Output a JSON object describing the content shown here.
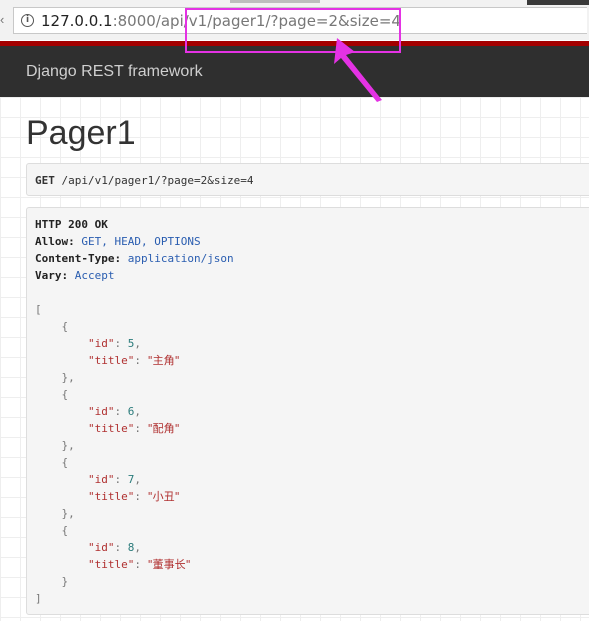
{
  "browser": {
    "url_host": "127.0.0.1",
    "url_rest": ":8000/api/v1/pager1/?page=2&size=4",
    "info_icon": "info-circle-icon"
  },
  "navbar": {
    "brand": "Django REST framework"
  },
  "page": {
    "title": "Pager1"
  },
  "request": {
    "method": "GET",
    "path": "/api/v1/pager1/?page=2&size=4"
  },
  "response": {
    "status_line": "HTTP 200 OK",
    "headers": [
      {
        "key": "Allow:",
        "value": "GET, HEAD, OPTIONS"
      },
      {
        "key": "Content-Type:",
        "value": "application/json"
      },
      {
        "key": "Vary:",
        "value": "Accept"
      }
    ],
    "items": [
      {
        "id_key": "\"id\"",
        "id": "5",
        "title_key": "\"title\"",
        "title": "\"主角\""
      },
      {
        "id_key": "\"id\"",
        "id": "6",
        "title_key": "\"title\"",
        "title": "\"配角\""
      },
      {
        "id_key": "\"id\"",
        "id": "7",
        "title_key": "\"title\"",
        "title": "\"小丑\""
      },
      {
        "id_key": "\"id\"",
        "id": "8",
        "title_key": "\"title\"",
        "title": "\"董事长\""
      }
    ]
  },
  "colors": {
    "annotation": "#e432e4",
    "navbar": "#2f2f2f",
    "nav_accent": "#a30000"
  }
}
